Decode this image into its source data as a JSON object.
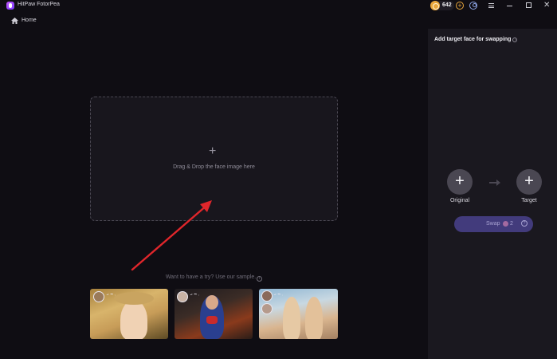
{
  "titlebar": {
    "app_title": "HitPaw FotorPea",
    "credits": "642",
    "icons": [
      "coin-icon",
      "add-credits-icon",
      "account-icon",
      "menu-icon",
      "minimize-icon",
      "maximize-icon",
      "close-icon"
    ]
  },
  "nav": {
    "home_label": "Home"
  },
  "main": {
    "drop_label": "Drag & Drop the face image here",
    "sample_title": "Want to have a try? Use our sample."
  },
  "panel": {
    "title": "Add target face for swapping",
    "original_label": "Original",
    "target_label": "Target",
    "swap_label": "Swap",
    "swap_cost": "2"
  },
  "colors": {
    "background": "#0f0d13",
    "panel": "#1a181f",
    "swap_button": "#423b7c",
    "annotation_arrow": "#e0262b",
    "coin": "#e8a63c"
  }
}
